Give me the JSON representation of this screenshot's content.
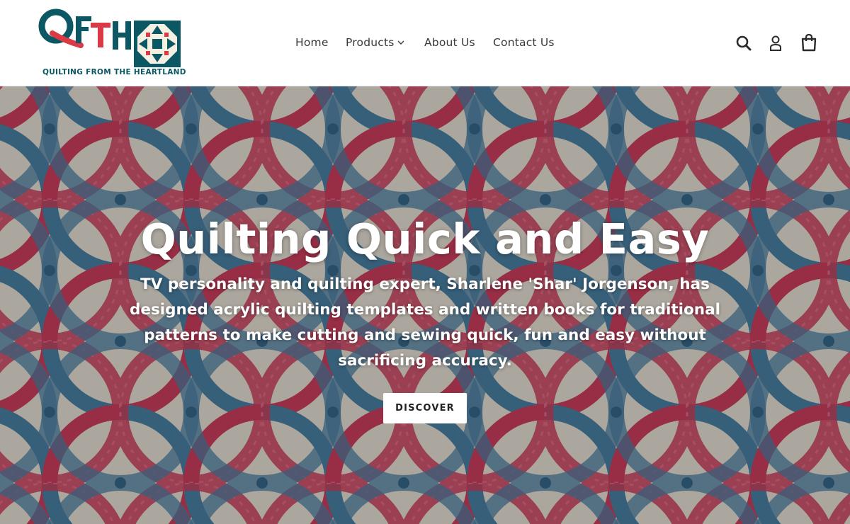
{
  "brand": {
    "logo_letters": "QFTH",
    "tagline": "QUILTING FROM THE HEARTLAND",
    "colors": {
      "teal": "#0b5763",
      "red": "#d93a45",
      "cream": "#f4f0e2"
    }
  },
  "nav": {
    "items": [
      {
        "label": "Home"
      },
      {
        "label": "Products",
        "has_dropdown": true
      },
      {
        "label": "About Us"
      },
      {
        "label": "Contact Us"
      }
    ]
  },
  "header_icons": {
    "search": "search-icon",
    "account": "account-icon",
    "cart": "cart-icon"
  },
  "hero": {
    "title": "Quilting Quick and Easy",
    "text": "TV personality and quilting expert, Sharlene 'Shar' Jorgenson, has designed acrylic quilting templates and written books for traditional patterns to make cutting and sewing quick, fun and easy without sacrificing accuracy.",
    "button_label": "DISCOVER",
    "colors": {
      "ring_red": "#b5344f",
      "ring_blue": "#3e6f8e",
      "background": "#cdc7bb"
    }
  }
}
